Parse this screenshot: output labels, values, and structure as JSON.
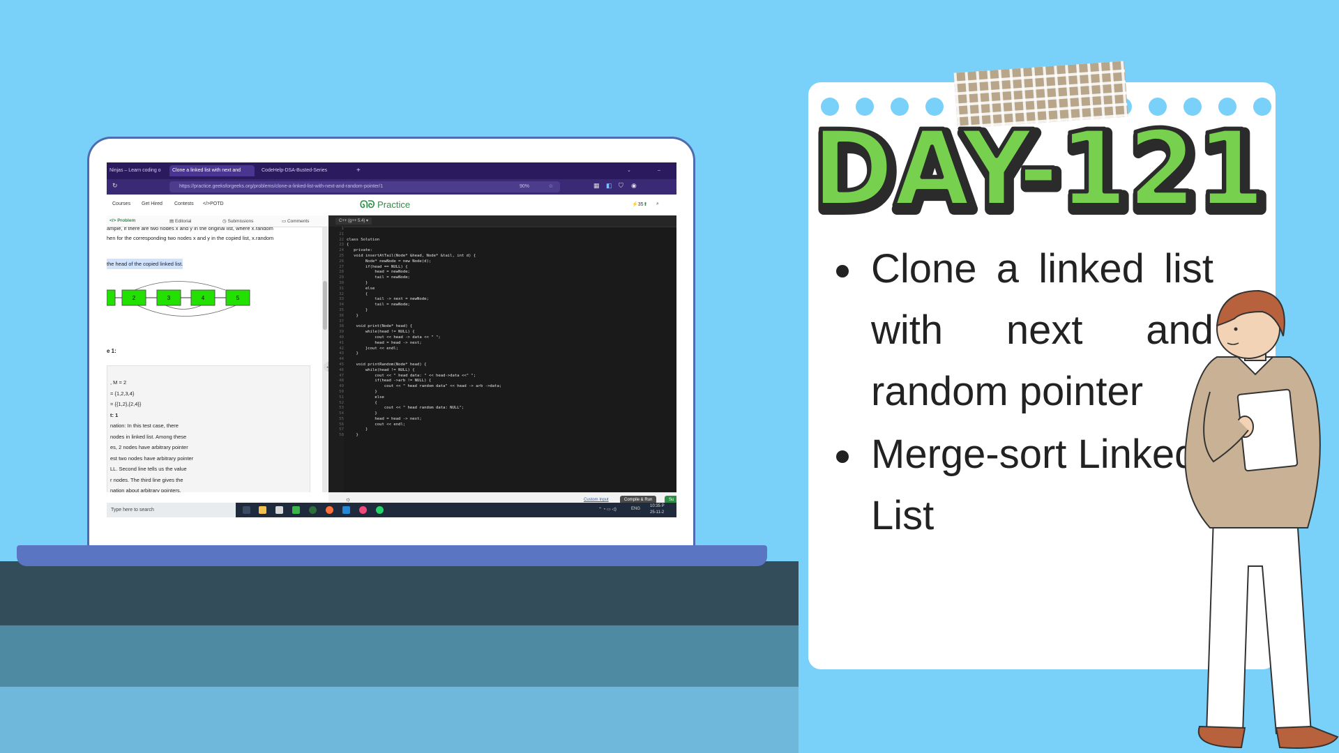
{
  "browser": {
    "tabs": [
      {
        "label": "Ninjas – Learn coding o",
        "active": false
      },
      {
        "label": "Clone a linked list with next and",
        "active": true
      },
      {
        "label": "CodeHelp-DSA-Busted-Series",
        "active": false
      }
    ],
    "url": "https://practice.geeksforgeeks.org/problems/clone-a-linked-list-with-next-and-random-pointer/1",
    "zoom": "90%"
  },
  "gfg_nav": {
    "courses": "Courses",
    "get_hired": "Get Hired",
    "contests": "Contests",
    "potd": "</>POTD",
    "brand": "Practice",
    "streak": "35"
  },
  "problem_tabs": {
    "problem": "Problem",
    "editorial": "Editorial",
    "submissions": "Submissions",
    "comments": "Comments"
  },
  "problem": {
    "line1": "ample, if there are two nodes x and y in the original list, where x.random",
    "line2": "hen for the corresponding two nodes x and y in the copied list, x.random",
    "highlight": "the head of the copied linked list.",
    "example_heading": "e 1:",
    "nodes": [
      "2",
      "3",
      "4",
      "5"
    ],
    "ex_lines": [
      ", M = 2",
      "= {1,2,3,4}",
      "= {{1,2},{2,4}}",
      "t: 1",
      "nation: In this test case, there",
      " nodes in linked list.  Among these",
      "es,  2 nodes have arbitrary pointer",
      "est two nodes have arbitrary pointer",
      "LL. Second line tells us the value",
      "r nodes. The third line gives the",
      "nation about arbitrary pointers."
    ]
  },
  "editor": {
    "language": "C++ (g++ 5.4)",
    "line_numbers": "1\n21\n22\n23\n24\n25\n26\n27\n28\n29\n30\n31\n32\n33\n34\n35\n36\n37\n38\n39\n40\n41\n42\n43\n44\n45\n46\n47\n48\n49\n50\n51\n52\n53\n54\n55\n56\n57\n58",
    "code": "\n\nclass Solution\n{\n   private:\n   void insertAtTail(Node* &head, Node* &tail, int d) {\n        Node* newNode = new Node(d);\n        if(head == NULL) {\n            head = newNode;\n            tail = newNode;\n        }\n        else\n        {\n            tail -> next = newNode;\n            tail = newNode;\n        }\n    }\n\n    void print(Node* head) {\n        while(head != NULL) {\n            cout << head -> data << \" \";\n            head = head -> next;\n        }cout << endl;\n    }\n\n    void printRandom(Node* head) {\n        while(head != NULL) {\n            cout << \" head data: \" << head->data <<\" \";\n            if(head ->arb != NULL) {\n                cout << \" head random data\" << head -> arb ->data;\n            }\n            else\n            {\n                cout << \" head random data: NULL\";\n            }\n            head = head -> next;\n            cout << endl;\n        }\n    }",
    "custom_input": "Custom Input",
    "compile_run": "Compile & Run",
    "submit": "Su"
  },
  "taskbar": {
    "search_placeholder": "Type here to search",
    "lang": "ENG",
    "time": "10:35 P",
    "date": "25-11-2"
  },
  "notepad": {
    "title": "DAY-121",
    "items": [
      "Clone a linked list with next and random pointer",
      "Merge-sort Linked List"
    ]
  },
  "colors": {
    "background": "#79d0f9",
    "title_green": "#77d14f",
    "gfg_green": "#2f8d46",
    "browser_purple": "#2b1a5e"
  }
}
